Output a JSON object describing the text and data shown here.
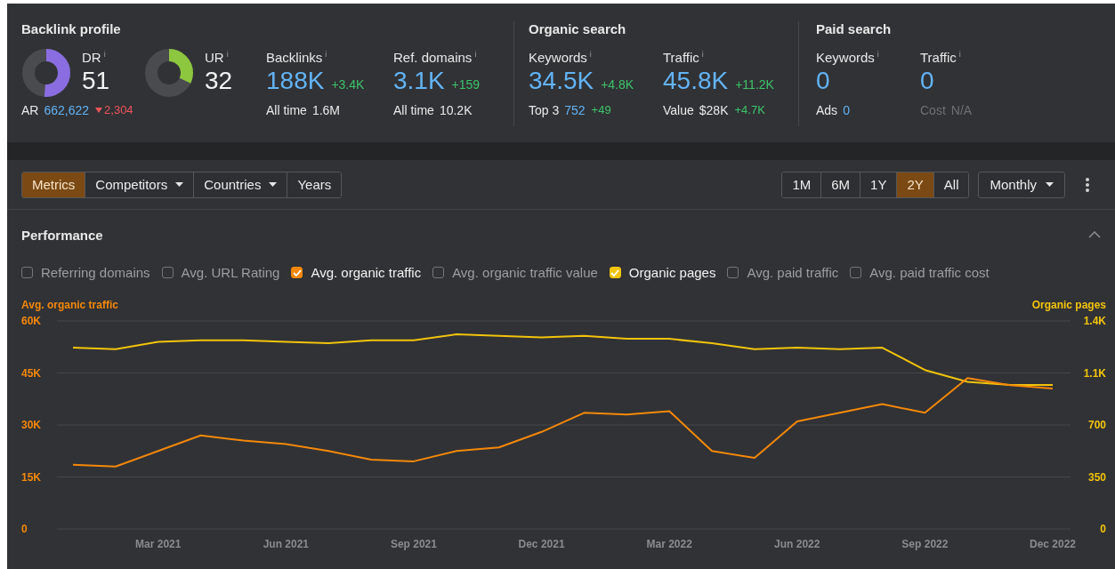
{
  "sections": [
    {
      "title": "Backlink profile",
      "metrics": [
        {
          "kind": "donut",
          "label": "DR",
          "info": "i",
          "value": "51",
          "level": 0.51,
          "color": "#8a6de0",
          "sub_label": "AR",
          "sub_value": "662,622",
          "sub_link": true,
          "sub_change": "2,304",
          "sub_negative": true
        },
        {
          "kind": "donut",
          "label": "UR",
          "info": "i",
          "value": "32",
          "level": 0.32,
          "color": "#8dc63f"
        },
        {
          "kind": "number",
          "label": "Backlinks",
          "info": "i",
          "value": "188K",
          "change": "+3.4K",
          "sub_label": "All time",
          "sub_value": "1.6M",
          "sub_link": false
        },
        {
          "kind": "number",
          "label": "Ref. domains",
          "info": "i",
          "value": "3.1K",
          "change": "+159",
          "sub_label": "All time",
          "sub_value": "10.2K",
          "sub_link": false
        }
      ]
    },
    {
      "title": "Organic search",
      "metrics": [
        {
          "kind": "number",
          "label": "Keywords",
          "info": "i",
          "value": "34.5K",
          "change": "+4.8K",
          "sub_label": "Top 3",
          "sub_value": "752",
          "sub_link": true,
          "sub_change": "+49",
          "sub_negative": false
        },
        {
          "kind": "number",
          "label": "Traffic",
          "info": "i",
          "value": "45.8K",
          "change": "+11.2K",
          "sub_label": "Value",
          "sub_value": "$28K",
          "sub_link": false,
          "sub_change": "+4.7K",
          "sub_negative": false
        }
      ]
    },
    {
      "title": "Paid search",
      "metrics": [
        {
          "kind": "number",
          "label": "Keywords",
          "info": "i",
          "value": "0",
          "sub_label": "Ads",
          "sub_value": "0",
          "sub_link": true
        },
        {
          "kind": "number",
          "label": "Traffic",
          "info": "i",
          "value": "0",
          "sub_label": "Cost",
          "sub_value": "N/A",
          "sub_link": false,
          "disabled": true
        }
      ]
    }
  ],
  "view_tabs": [
    {
      "label": "Metrics",
      "selected": true,
      "has_menu": false
    },
    {
      "label": "Competitors",
      "selected": false,
      "has_menu": true
    },
    {
      "label": "Countries",
      "selected": false,
      "has_menu": true
    },
    {
      "label": "Years",
      "selected": false,
      "has_menu": false
    }
  ],
  "ranges": [
    {
      "label": "1M",
      "selected": false
    },
    {
      "label": "6M",
      "selected": false
    },
    {
      "label": "1Y",
      "selected": false
    },
    {
      "label": "2Y",
      "selected": true
    },
    {
      "label": "All",
      "selected": false
    }
  ],
  "interval": {
    "label": "Monthly"
  },
  "performance": {
    "title": "Performance",
    "expanded": true,
    "series_toggles": [
      {
        "label": "Referring domains",
        "checked": false
      },
      {
        "label": "Avg. URL Rating",
        "checked": false
      },
      {
        "label": "Avg. organic traffic",
        "checked": true,
        "color": "#f5880a"
      },
      {
        "label": "Avg. organic traffic value",
        "checked": false
      },
      {
        "label": "Organic pages",
        "checked": true,
        "color": "#f2c40c"
      },
      {
        "label": "Avg. paid traffic",
        "checked": false
      },
      {
        "label": "Avg. paid traffic cost",
        "checked": false
      }
    ],
    "chart_data": {
      "type": "line",
      "grid": true,
      "ylabel": "Avg. organic traffic",
      "y2label": "Organic pages",
      "categories": [
        null,
        null,
        "Mar 2021",
        null,
        null,
        "Jun 2021",
        null,
        null,
        "Sep 2021",
        null,
        null,
        "Dec 2021",
        null,
        null,
        "Mar 2022",
        null,
        null,
        "Jun 2022",
        null,
        null,
        "Sep 2022",
        null,
        null,
        "Dec 2022"
      ],
      "ylim": [
        0,
        60000
      ],
      "yticks": [
        0,
        {
          "value": 15000,
          "label": "15K"
        },
        {
          "value": 30000,
          "label": "30K"
        },
        {
          "value": 45000,
          "label": "45K"
        },
        {
          "value": 60000,
          "label": "60K"
        }
      ],
      "y2lim": [
        0,
        1400
      ],
      "y2ticks": [
        0,
        350,
        700,
        {
          "value": 1050,
          "label": "1.1K"
        },
        {
          "value": 1400,
          "label": "1.4K"
        }
      ],
      "series": [
        {
          "axis": "y2",
          "color": "#f2c40c",
          "values": [
            1220,
            1210,
            1260,
            1270,
            1270,
            1260,
            1250,
            1270,
            1270,
            1310,
            1300,
            1290,
            1300,
            1280,
            1280,
            1250,
            1210,
            1220,
            1210,
            1220,
            1070,
            990,
            970,
            970
          ]
        },
        {
          "color": "#f5880a",
          "values": [
            18500,
            18000,
            22500,
            27000,
            25500,
            24500,
            22500,
            20000,
            19500,
            22500,
            23500,
            28000,
            33500,
            33000,
            34000,
            22500,
            20500,
            31000,
            33500,
            36000,
            33500,
            43500,
            41500,
            40500
          ]
        }
      ]
    }
  }
}
